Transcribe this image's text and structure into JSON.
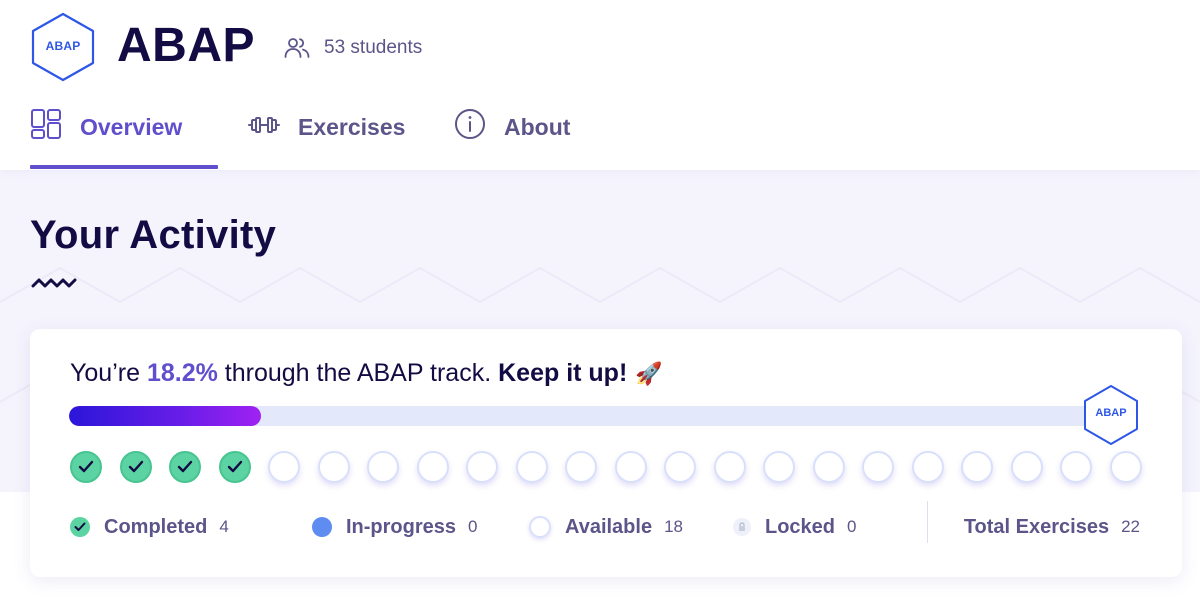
{
  "header": {
    "logo_text": "ABAP",
    "title": "ABAP",
    "students": "53 students",
    "students_icon": "people-icon"
  },
  "tabs": [
    {
      "label": "Overview",
      "icon": "overview-grid-icon",
      "active": true
    },
    {
      "label": "Exercises",
      "icon": "dumbbell-icon",
      "active": false
    },
    {
      "label": "About",
      "icon": "info-icon",
      "active": false
    }
  ],
  "activity": {
    "title": "Your Activity",
    "progress_prefix": "You’re",
    "progress_percent": "18.2%",
    "progress_middle": "through the ABAP track.",
    "progress_emphasis": "Keep it up!",
    "progress_emoji": "🚀",
    "progress_fraction": 0.182,
    "badge_text": "ABAP",
    "exercise_states": [
      "completed",
      "completed",
      "completed",
      "completed",
      "available",
      "available",
      "available",
      "available",
      "available",
      "available",
      "available",
      "available",
      "available",
      "available",
      "available",
      "available",
      "available",
      "available",
      "available",
      "available",
      "available",
      "available"
    ],
    "legend": {
      "completed_label": "Completed",
      "completed_count": "4",
      "in_progress_label": "In-progress",
      "in_progress_count": "0",
      "available_label": "Available",
      "available_count": "18",
      "locked_label": "Locked",
      "locked_count": "0",
      "total_label": "Total Exercises",
      "total_count": "22"
    }
  },
  "colors": {
    "accent": "#604fcd",
    "text_dark": "#130b43",
    "text_muted": "#5c5589",
    "completed": "#5bd3a2",
    "in_progress": "#5e8cf0",
    "progress_bar_start": "#2b16d9",
    "progress_bar_end": "#9f22f2"
  }
}
